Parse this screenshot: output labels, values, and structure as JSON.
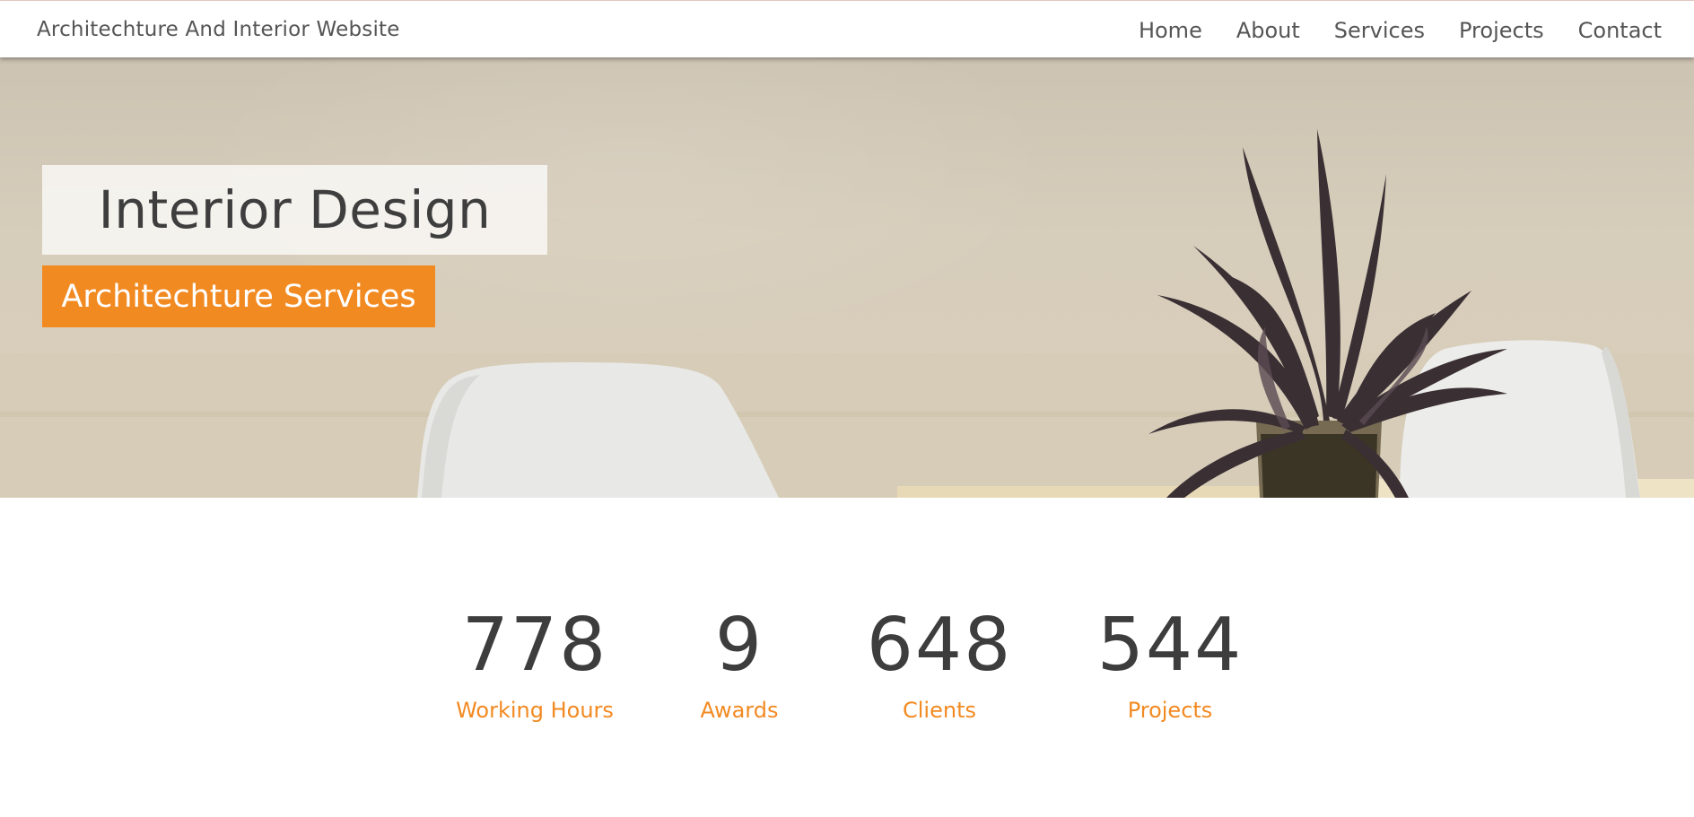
{
  "nav": {
    "brand": "Architechture And Interior Website",
    "links": [
      "Home",
      "About",
      "Services",
      "Projects",
      "Contact"
    ]
  },
  "hero": {
    "title": "Interior Design",
    "subtitle": "Architechture Services"
  },
  "stats": [
    {
      "value": "778",
      "label": "Working Hours"
    },
    {
      "value": "9",
      "label": "Awards"
    },
    {
      "value": "648",
      "label": "Clients"
    },
    {
      "value": "544",
      "label": "Projects"
    }
  ],
  "colors": {
    "accent": "#f28a22",
    "text": "#444444",
    "wall": "#d6ccba"
  }
}
